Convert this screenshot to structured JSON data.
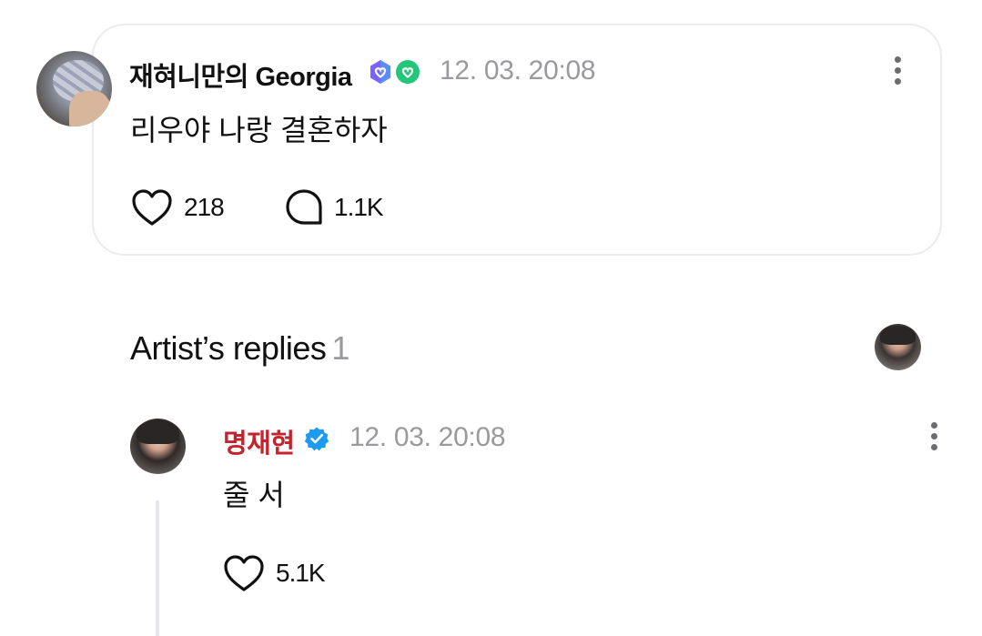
{
  "post": {
    "author": "재혀니만의 Georgia",
    "badges": [
      "membership-badge-purple",
      "membership-badge-green"
    ],
    "timestamp": "12. 03. 20:08",
    "text": "리우야 나랑 결혼하자",
    "likes": "218",
    "comments": "1.1K"
  },
  "replies_section": {
    "title": "Artist’s replies",
    "count": "1"
  },
  "reply": {
    "author": "명재현",
    "author_color": "#c3242c",
    "badge": "verified-badge",
    "timestamp": "12. 03. 20:08",
    "text": "줄 서",
    "likes": "5.1K"
  },
  "colors": {
    "muted": "#9a9a9e",
    "border": "#ececef",
    "verified": "#1d9bf0"
  }
}
